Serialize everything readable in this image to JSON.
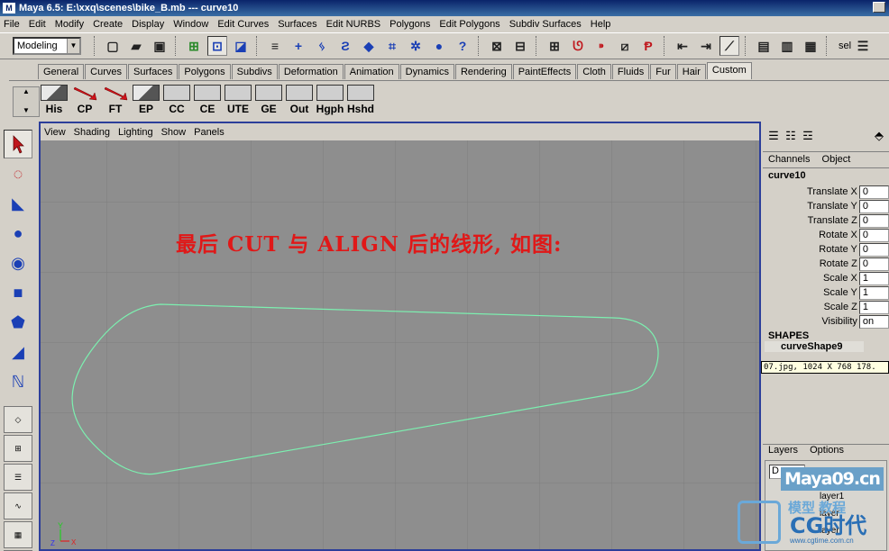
{
  "window": {
    "title": "Maya 6.5: E:\\xxq\\scenes\\bike_B.mb  ---  curve10"
  },
  "menubar": [
    "File",
    "Edit",
    "Modify",
    "Create",
    "Display",
    "Window",
    "Edit Curves",
    "Surfaces",
    "Edit NURBS",
    "Polygons",
    "Edit Polygons",
    "Subdiv Surfaces",
    "Help"
  ],
  "statusline": {
    "mode": "Modeling",
    "sel_label": "sel"
  },
  "shelf_tabs": [
    "General",
    "Curves",
    "Surfaces",
    "Polygons",
    "Subdivs",
    "Deformation",
    "Animation",
    "Dynamics",
    "Rendering",
    "PaintEffects",
    "Cloth",
    "Fluids",
    "Fur",
    "Hair",
    "Custom"
  ],
  "shelf_active_tab": "Custom",
  "shelf_buttons": [
    "His",
    "CP",
    "FT",
    "EP",
    "CC",
    "CE",
    "UTE",
    "GE",
    "Out",
    "Hgph",
    "Hshd"
  ],
  "viewport": {
    "menu": [
      "View",
      "Shading",
      "Lighting",
      "Show",
      "Panels"
    ],
    "annotation": "最后 CUT 与 ALIGN 后的线形,  如图:",
    "axis_labels": {
      "y": "Y",
      "x": "X",
      "z": "Z"
    },
    "curve_color": "#7cf0b0"
  },
  "channel_box": {
    "tabs": [
      "Channels",
      "Object"
    ],
    "object_name": "curve10",
    "attributes": [
      {
        "name": "Translate X",
        "value": "0"
      },
      {
        "name": "Translate Y",
        "value": "0"
      },
      {
        "name": "Translate Z",
        "value": "0"
      },
      {
        "name": "Rotate X",
        "value": "0"
      },
      {
        "name": "Rotate Y",
        "value": "0"
      },
      {
        "name": "Rotate Z",
        "value": "0"
      },
      {
        "name": "Scale X",
        "value": "1"
      },
      {
        "name": "Scale Y",
        "value": "1"
      },
      {
        "name": "Scale Z",
        "value": "1"
      },
      {
        "name": "Visibility",
        "value": "on"
      }
    ],
    "shapes_label": "SHAPES",
    "shape_name": "curveShape9",
    "tooltip": "07.jpg, 1024 X 768 178."
  },
  "layers": {
    "tabs": [
      "Layers",
      "Options"
    ],
    "display_value": "D",
    "rows": [
      "layer1",
      "layer",
      "layer"
    ]
  },
  "watermark": {
    "site": "Maya09.cn",
    "brand": "CG时代",
    "cn_text": "模型 教程",
    "url": "www.cgtime.com.cn"
  },
  "colors": {
    "viewport_bg": "#8e8e8e",
    "grid": "#7d7d7d",
    "annotation": "#e01818",
    "viewport_border": "#2c3e9a"
  }
}
